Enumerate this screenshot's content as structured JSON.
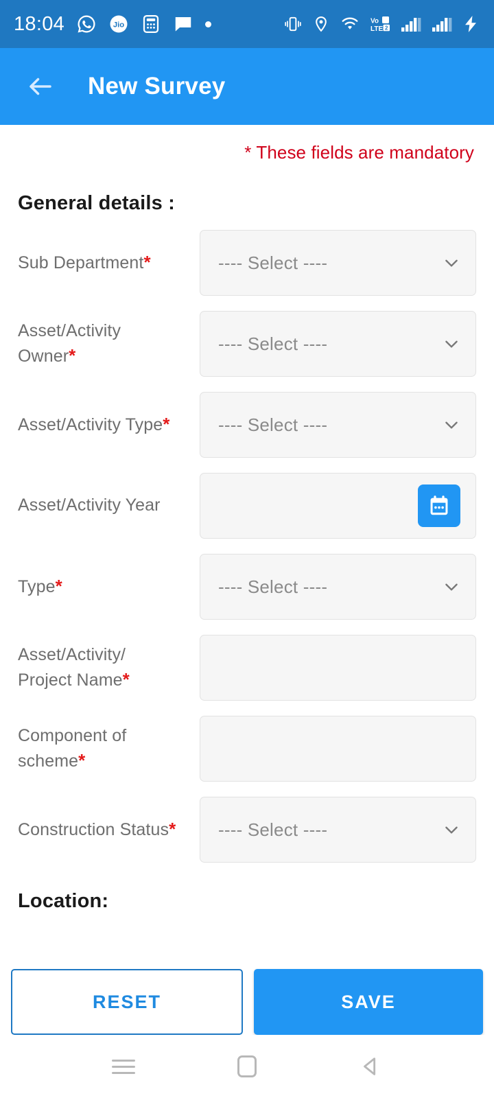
{
  "status_bar": {
    "time": "18:04",
    "left_icons": [
      "whatsapp-icon",
      "jio-icon",
      "calculator-icon",
      "message-icon",
      "dot-icon"
    ],
    "right_icons": [
      "vibrate-icon",
      "location-icon",
      "wifi-icon",
      "volte-icon",
      "signal-sim1-icon",
      "signal-sim2-icon",
      "charging-bolt-icon"
    ],
    "volte_label_top": "VoD",
    "volte_label_bottom": "LTE2",
    "background_color": "#1f78c1"
  },
  "app_bar": {
    "title": "New Survey",
    "back_icon": "arrow-left-icon",
    "background_color": "#2196f3"
  },
  "form": {
    "mandatory_note": "* These fields are mandatory",
    "mandatory_color": "#d0021b",
    "general_section_title": "General details :",
    "location_section_title": "Location:",
    "select_placeholder": "---- Select ----",
    "fields": [
      {
        "label": "Sub Department",
        "required": true,
        "type": "select",
        "value": "---- Select ----"
      },
      {
        "label": "Asset/Activity Owner",
        "required": true,
        "type": "select",
        "value": "---- Select ----"
      },
      {
        "label": "Asset/Activity Type",
        "required": true,
        "type": "select",
        "value": "---- Select ----"
      },
      {
        "label": "Asset/Activity Year",
        "required": false,
        "type": "date",
        "value": ""
      },
      {
        "label": "Type",
        "required": true,
        "type": "select",
        "value": "---- Select ----"
      },
      {
        "label": "Asset/Activity/ Project Name",
        "required": true,
        "type": "text",
        "value": ""
      },
      {
        "label": "Component of scheme",
        "required": true,
        "type": "text",
        "value": ""
      },
      {
        "label": "Construction Status",
        "required": true,
        "type": "select",
        "value": "---- Select ----"
      }
    ],
    "labels": {
      "sub_department": "Sub Department",
      "asset_owner_line1": "Asset/Activity",
      "asset_owner_line2": "Owner",
      "asset_type": "Asset/Activity Type",
      "asset_year": "Asset/Activity Year",
      "type": "Type",
      "project_name_line1": "Asset/Activity/",
      "project_name_line2": "Project Name",
      "component_line1": "Component of",
      "component_line2": "scheme",
      "construction_status": "Construction Status"
    },
    "asterisk": "*"
  },
  "buttons": {
    "reset_label": "RESET",
    "save_label": "SAVE",
    "reset_color": "#1f8ae0",
    "save_color": "#2196f3"
  },
  "nav_bar": {
    "items": [
      "recents-icon",
      "home-icon",
      "back-icon"
    ]
  }
}
